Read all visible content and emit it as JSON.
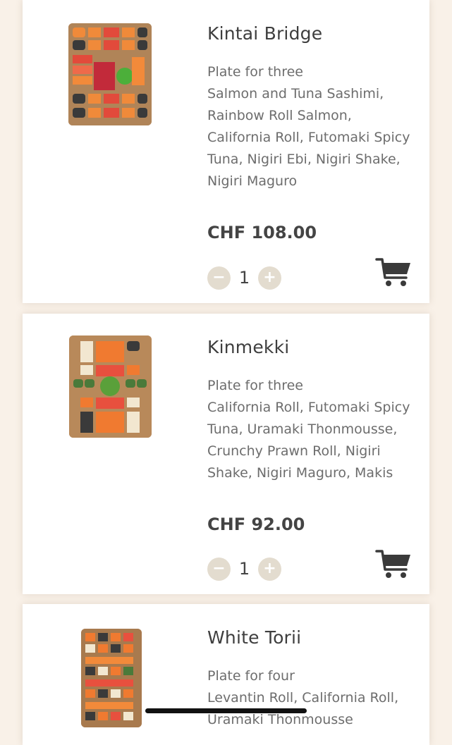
{
  "products": [
    {
      "name": "Kintai Bridge",
      "description_lines": [
        "Plate for three",
        "Salmon and Tuna Sashimi,",
        "Rainbow Roll Salmon,",
        "California Roll, Futomaki Spicy",
        "Tuna, Nigiri Ebi, Nigiri Shake,",
        "Nigiri Maguro"
      ],
      "price": "CHF 108.00",
      "quantity": "1",
      "minus": "−",
      "plus": "+"
    },
    {
      "name": "Kinmekki",
      "description_lines": [
        "Plate for three",
        "California Roll, Futomaki Spicy",
        "Tuna, Uramaki Thonmousse,",
        "Crunchy Prawn Roll, Nigiri",
        "Shake, Nigiri Maguro, Makis"
      ],
      "price": "CHF 92.00",
      "quantity": "1",
      "minus": "−",
      "plus": "+"
    },
    {
      "name": "White Torii",
      "description_lines": [
        "Plate for four",
        "Levantin Roll, California Roll,",
        "Uramaki Thonmousse"
      ]
    }
  ],
  "icons": {
    "cart": "cart-icon",
    "minus": "minus-icon",
    "plus": "plus-icon"
  },
  "colors": {
    "background": "#f9f1e8",
    "card": "#ffffff",
    "stepper": "#e3dccf",
    "cart": "#3a3a3a"
  }
}
